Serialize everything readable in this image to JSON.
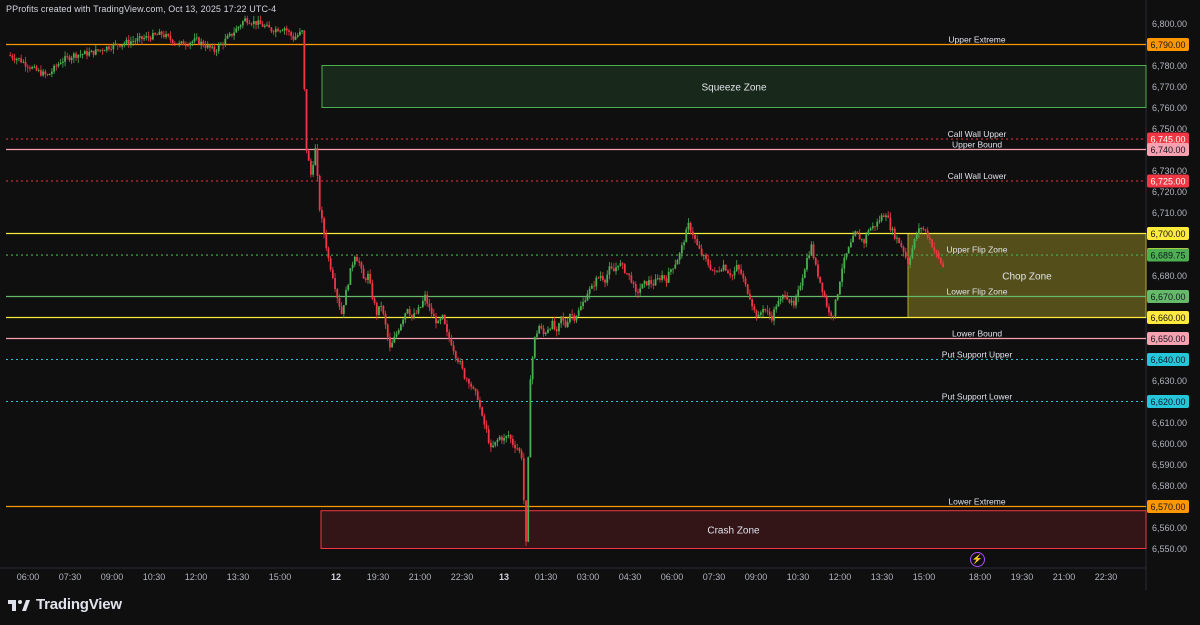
{
  "header": {
    "text": "PProfits created with TradingView.com, Oct 13, 2025 17:22 UTC-4"
  },
  "brand": {
    "name": "TradingView"
  },
  "chart_data": {
    "type": "candlestick",
    "title": "",
    "y_range": [
      6545,
      6805
    ],
    "y_ticks": [
      6550,
      6560,
      6570,
      6580,
      6590,
      6600,
      6610,
      6620,
      6630,
      6640,
      6650,
      6660,
      6670,
      6680,
      6690,
      6700,
      6710,
      6720,
      6730,
      6740,
      6750,
      6760,
      6770,
      6780,
      6790,
      6800
    ],
    "x_ticks": [
      "06:00",
      "07:30",
      "09:00",
      "10:30",
      "12:00",
      "13:30",
      "15:00",
      "12",
      "19:30",
      "21:00",
      "22:30",
      "13",
      "01:30",
      "03:00",
      "04:30",
      "06:00",
      "07:30",
      "09:00",
      "10:30",
      "12:00",
      "13:30",
      "15:00",
      "18:00",
      "19:30",
      "21:00",
      "22:30"
    ],
    "levels": [
      {
        "label": "Upper Extreme",
        "value": 6790,
        "price_label": "6,790.00",
        "color": "#ff9800",
        "style": "solid"
      },
      {
        "label": "Call Wall Upper",
        "value": 6745,
        "price_label": "6,745.00",
        "color": "#f23645",
        "style": "dotted"
      },
      {
        "label": "Upper Bound",
        "value": 6740,
        "price_label": "6,740.00",
        "color": "#f7a1b0",
        "style": "solid"
      },
      {
        "label": "Call Wall Lower",
        "value": 6725,
        "price_label": "6,725.00",
        "color": "#f23645",
        "style": "dotted"
      },
      {
        "label": "",
        "value": 6700,
        "price_label": "6,700.00",
        "color": "#ffeb3b",
        "style": "solid"
      },
      {
        "label": "Upper Flip Zone",
        "value": 6690,
        "price_label": "6,690.00",
        "color": "#ffeb3b",
        "style": "none"
      },
      {
        "label": "",
        "value": 6689.75,
        "price_label": "6,689.75",
        "color": "#4caf50",
        "style": "dotted"
      },
      {
        "label": "Lower Flip Zone",
        "value": 6670,
        "price_label": "6,670.00",
        "color": "#66bb6a",
        "style": "solid"
      },
      {
        "label": "",
        "value": 6660,
        "price_label": "6,660.00",
        "color": "#ffeb3b",
        "style": "solid"
      },
      {
        "label": "Lower Bound",
        "value": 6650,
        "price_label": "6,650.00",
        "color": "#f7a1b0",
        "style": "solid"
      },
      {
        "label": "Put Support Upper",
        "value": 6640,
        "price_label": "6,640.00",
        "color": "#26c6da",
        "style": "dotted"
      },
      {
        "label": "Put Support Lower",
        "value": 6620,
        "price_label": "6,620.00",
        "color": "#26c6da",
        "style": "dotted"
      },
      {
        "label": "Lower Extreme",
        "value": 6570,
        "price_label": "6,570.00",
        "color": "#ff9800",
        "style": "solid"
      }
    ],
    "zones": [
      {
        "label": "Squeeze Zone",
        "from": 6760,
        "to": 6780,
        "fill": "rgba(76,175,80,0.16)",
        "border": "#4caf50"
      },
      {
        "label": "Chop Zone",
        "from": 6660,
        "to": 6700,
        "fill": "rgba(180,170,40,0.42)",
        "border": "#b5ae2e"
      },
      {
        "label": "Crash Zone",
        "from": 6550,
        "to": 6568,
        "fill": "rgba(242,54,69,0.16)",
        "border": "#f23645"
      }
    ],
    "path": [
      [
        0,
        6785
      ],
      [
        5,
        6783
      ],
      [
        12,
        6778
      ],
      [
        18,
        6775
      ],
      [
        24,
        6782
      ],
      [
        30,
        6785
      ],
      [
        38,
        6786
      ],
      [
        46,
        6789
      ],
      [
        54,
        6791
      ],
      [
        62,
        6793
      ],
      [
        70,
        6795
      ],
      [
        78,
        6790
      ],
      [
        86,
        6792
      ],
      [
        94,
        6787
      ],
      [
        102,
        6795
      ],
      [
        108,
        6802
      ],
      [
        114,
        6800
      ],
      [
        120,
        6797
      ],
      [
        126,
        6798
      ],
      [
        130,
        6793
      ],
      [
        134,
        6796
      ],
      [
        136,
        6740
      ],
      [
        138,
        6728
      ],
      [
        140,
        6740
      ],
      [
        142,
        6712
      ],
      [
        144,
        6700
      ],
      [
        146,
        6688
      ],
      [
        148,
        6680
      ],
      [
        150,
        6670
      ],
      [
        152,
        6662
      ],
      [
        154,
        6672
      ],
      [
        156,
        6682
      ],
      [
        158,
        6690
      ],
      [
        160,
        6686
      ],
      [
        162,
        6678
      ],
      [
        164,
        6680
      ],
      [
        166,
        6670
      ],
      [
        168,
        6662
      ],
      [
        170,
        6666
      ],
      [
        172,
        6656
      ],
      [
        174,
        6645
      ],
      [
        176,
        6650
      ],
      [
        178,
        6655
      ],
      [
        180,
        6660
      ],
      [
        182,
        6665
      ],
      [
        184,
        6660
      ],
      [
        186,
        6662
      ],
      [
        188,
        6665
      ],
      [
        190,
        6670
      ],
      [
        192,
        6664
      ],
      [
        194,
        6660
      ],
      [
        196,
        6657
      ],
      [
        198,
        6660
      ],
      [
        200,
        6652
      ],
      [
        202,
        6648
      ],
      [
        204,
        6642
      ],
      [
        206,
        6638
      ],
      [
        208,
        6632
      ],
      [
        210,
        6630
      ],
      [
        212,
        6625
      ],
      [
        214,
        6622
      ],
      [
        216,
        6612
      ],
      [
        218,
        6606
      ],
      [
        220,
        6597
      ],
      [
        222,
        6600
      ],
      [
        224,
        6603
      ],
      [
        226,
        6602
      ],
      [
        228,
        6604
      ],
      [
        230,
        6600
      ],
      [
        232,
        6598
      ],
      [
        234,
        6594
      ],
      [
        236,
        6552
      ],
      [
        238,
        6632
      ],
      [
        240,
        6650
      ],
      [
        242,
        6656
      ],
      [
        244,
        6652
      ],
      [
        246,
        6655
      ],
      [
        248,
        6657
      ],
      [
        250,
        6652
      ],
      [
        252,
        6660
      ],
      [
        254,
        6656
      ],
      [
        256,
        6662
      ],
      [
        258,
        6660
      ],
      [
        260,
        6663
      ],
      [
        262,
        6667
      ],
      [
        264,
        6672
      ],
      [
        266,
        6674
      ],
      [
        268,
        6678
      ],
      [
        270,
        6680
      ],
      [
        272,
        6678
      ],
      [
        274,
        6683
      ],
      [
        276,
        6682
      ],
      [
        278,
        6686
      ],
      [
        280,
        6684
      ],
      [
        282,
        6681
      ],
      [
        284,
        6678
      ],
      [
        286,
        6671
      ],
      [
        288,
        6674
      ],
      [
        290,
        6676
      ],
      [
        292,
        6677
      ],
      [
        294,
        6676
      ],
      [
        296,
        6678
      ],
      [
        298,
        6680
      ],
      [
        300,
        6678
      ],
      [
        302,
        6683
      ],
      [
        304,
        6686
      ],
      [
        306,
        6690
      ],
      [
        308,
        6697
      ],
      [
        310,
        6704
      ],
      [
        312,
        6700
      ],
      [
        314,
        6694
      ],
      [
        316,
        6690
      ],
      [
        318,
        6687
      ],
      [
        320,
        6684
      ],
      [
        322,
        6681
      ],
      [
        324,
        6683
      ],
      [
        326,
        6685
      ],
      [
        328,
        6682
      ],
      [
        330,
        6680
      ],
      [
        332,
        6684
      ],
      [
        334,
        6681
      ],
      [
        336,
        6675
      ],
      [
        338,
        6670
      ],
      [
        340,
        6663
      ],
      [
        342,
        6660
      ],
      [
        344,
        6665
      ],
      [
        346,
        6662
      ],
      [
        348,
        6660
      ],
      [
        350,
        6666
      ],
      [
        352,
        6668
      ],
      [
        354,
        6672
      ],
      [
        356,
        6668
      ],
      [
        358,
        6665
      ],
      [
        360,
        6672
      ],
      [
        362,
        6680
      ],
      [
        364,
        6688
      ],
      [
        366,
        6694
      ],
      [
        368,
        6684
      ],
      [
        370,
        6677
      ],
      [
        372,
        6670
      ],
      [
        374,
        6662
      ],
      [
        376,
        6662
      ],
      [
        378,
        6672
      ],
      [
        380,
        6684
      ],
      [
        382,
        6690
      ],
      [
        384,
        6695
      ],
      [
        386,
        6700
      ],
      [
        388,
        6698
      ],
      [
        390,
        6696
      ],
      [
        392,
        6702
      ],
      [
        394,
        6703
      ],
      [
        396,
        6705
      ],
      [
        398,
        6708
      ],
      [
        400,
        6710
      ],
      [
        402,
        6703
      ],
      [
        404,
        6699
      ],
      [
        406,
        6696
      ],
      [
        408,
        6692
      ],
      [
        410,
        6686
      ],
      [
        412,
        6693
      ],
      [
        414,
        6700
      ],
      [
        416,
        6703
      ],
      [
        418,
        6701
      ],
      [
        420,
        6697
      ],
      [
        422,
        6692
      ],
      [
        424,
        6688
      ],
      [
        426,
        6684
      ]
    ]
  }
}
